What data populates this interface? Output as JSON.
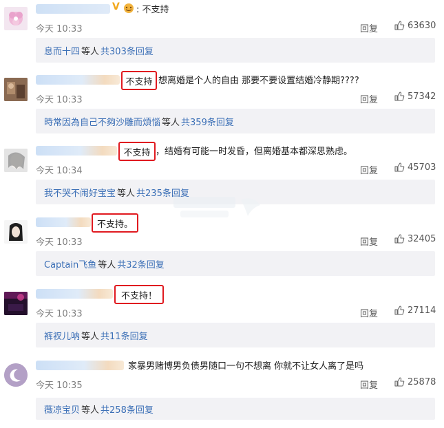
{
  "comments": [
    {
      "text_after": "不支持",
      "prefix_symbol": "V",
      "time": "今天 10:33",
      "reply_label": "回复",
      "likes": "63630",
      "replies": {
        "name": "息而十四",
        "etc": "等人",
        "total": "共303条回复"
      }
    },
    {
      "highlight": "不支持",
      "text_after": "想离婚是个人的自由 那要不要设置结婚冷静期????",
      "time": "今天 10:33",
      "reply_label": "回复",
      "likes": "57342",
      "replies": {
        "name": "時常因為自己不夠沙雕而煩惱",
        "etc": "等人",
        "total": "共359条回复"
      }
    },
    {
      "highlight": "不支持",
      "text_after": "，结婚有可能一时发昏，但离婚基本都深思熟虑。",
      "time": "今天 10:34",
      "reply_label": "回复",
      "likes": "45703",
      "replies": {
        "name": "我不哭不闹好宝宝",
        "etc": "等人",
        "total": "共235条回复"
      }
    },
    {
      "highlight": "不支持。",
      "text_after": "",
      "time": "今天 10:33",
      "reply_label": "回复",
      "likes": "32405",
      "replies": {
        "name": "Captain飞鱼",
        "etc": "等人",
        "total": "共32条回复"
      }
    },
    {
      "highlight": "不支持！",
      "text_after": "",
      "time": "今天 10:33",
      "reply_label": "回复",
      "likes": "27114",
      "replies": {
        "name": "裤衩儿呐",
        "etc": "等人",
        "total": "共11条回复"
      }
    },
    {
      "text_after": "家暴男赌博男负债男随口一句不想离 你就不让女人离了是吗",
      "time": "今天 10:35",
      "reply_label": "回复",
      "likes": "25878",
      "replies": {
        "name": "薇凉宝贝",
        "etc": "等人",
        "total": "共258条回复"
      }
    }
  ],
  "icons": {
    "like": "thumbs-up-icon"
  },
  "colors": {
    "highlight": "#e0191f",
    "link": "#3b6fb6",
    "reply_bg": "#f2f2f5"
  }
}
